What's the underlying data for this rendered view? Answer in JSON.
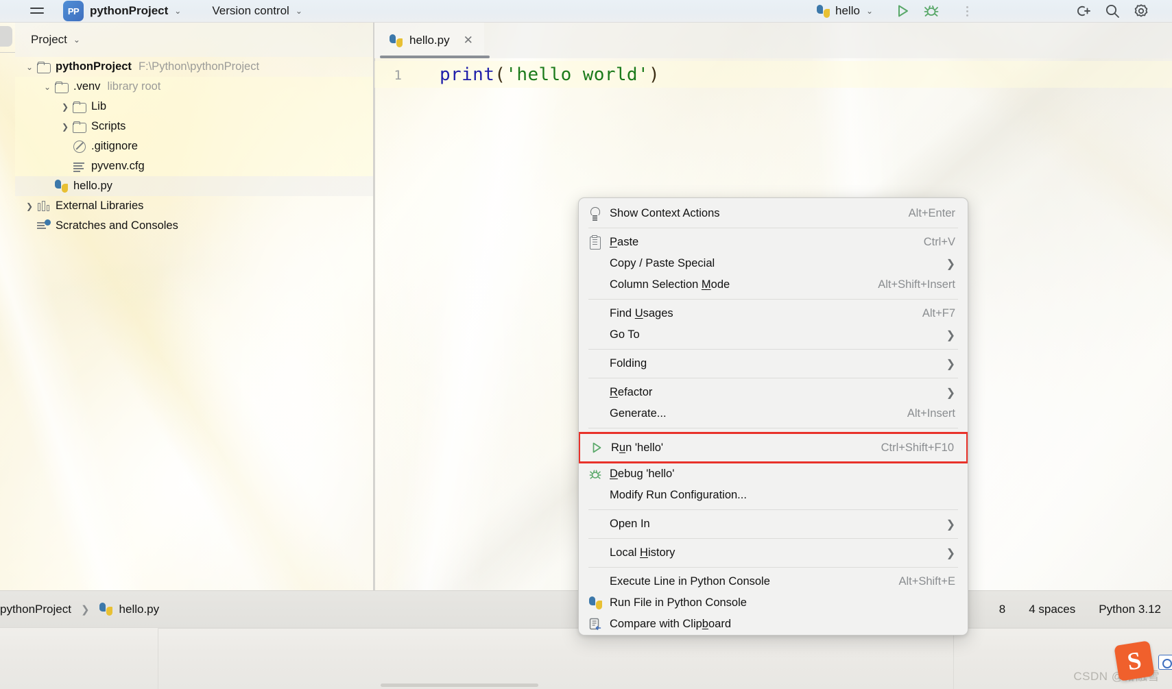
{
  "toolbar": {
    "burger_icon": "hamburger-menu-icon",
    "project_badge": "PP",
    "project_name": "pythonProject",
    "version_control": "Version control",
    "run_config_name": "hello",
    "chevron_icon": "chevron-down-icon",
    "run_icon": "run-triangle-icon",
    "debug_icon": "debug-bug-icon",
    "more_icon": "more-vertical-dots-icon",
    "ai_icon": "code-with-me-icon",
    "search_icon": "search-icon",
    "settings_icon": "gear-icon"
  },
  "left_stripe": {
    "items": [
      "project-tool-window-icon",
      "commit-icon",
      "bookmarks-icon",
      "structure-icon",
      "notifications-icon",
      "terminal-icon",
      "python-packages-icon",
      "problems-icon",
      "services-icon"
    ]
  },
  "project_panel": {
    "title": "Project",
    "title_chevron": "chevron-down-icon",
    "tree": [
      {
        "label": "pythonProject",
        "sub": "F:\\Python\\pythonProject",
        "indent": 0,
        "arrow": "chevron-down-icon",
        "icon": "folder-icon",
        "bold": true,
        "highlight": "none"
      },
      {
        "label": ".venv",
        "sub": "library root",
        "indent": 1,
        "arrow": "chevron-down-icon",
        "icon": "folder-icon",
        "bold": false,
        "highlight": "yellow"
      },
      {
        "label": "Lib",
        "sub": "",
        "indent": 2,
        "arrow": "chevron-right-icon",
        "icon": "folder-icon",
        "bold": false,
        "highlight": "yellow"
      },
      {
        "label": "Scripts",
        "sub": "",
        "indent": 2,
        "arrow": "chevron-right-icon",
        "icon": "folder-icon",
        "bold": false,
        "highlight": "yellow"
      },
      {
        "label": ".gitignore",
        "sub": "",
        "indent": 2,
        "arrow": "none",
        "icon": "gitignore-file-icon",
        "bold": false,
        "highlight": "yellow"
      },
      {
        "label": "pyvenv.cfg",
        "sub": "",
        "indent": 2,
        "arrow": "none",
        "icon": "config-file-icon",
        "bold": false,
        "highlight": "yellow"
      },
      {
        "label": "hello.py",
        "sub": "",
        "indent": 1,
        "arrow": "none",
        "icon": "python-file-icon",
        "bold": false,
        "highlight": "grey"
      },
      {
        "label": "External Libraries",
        "sub": "",
        "indent": 0,
        "arrow": "chevron-right-icon",
        "icon": "library-icon",
        "bold": false,
        "highlight": "none"
      },
      {
        "label": "Scratches and Consoles",
        "sub": "",
        "indent": 0,
        "arrow": "none",
        "icon": "scratches-icon",
        "bold": false,
        "highlight": "none"
      }
    ]
  },
  "editor": {
    "tab": {
      "name": "hello.py",
      "icon": "python-file-icon",
      "close_icon": "close-icon"
    },
    "line_numbers": [
      "1"
    ],
    "code": {
      "func": "print",
      "open_paren": "(",
      "string": "'hello world'",
      "close_paren": ")"
    }
  },
  "context_menu": {
    "groups": [
      {
        "items": [
          {
            "icon": "lightbulb-icon",
            "label": "Show Context Actions",
            "mnemonic": "",
            "accel": "Alt+Enter",
            "submenu": false
          }
        ]
      },
      {
        "items": [
          {
            "icon": "clipboard-icon",
            "label": "Paste",
            "mnemonic": "P",
            "accel": "Ctrl+V",
            "submenu": false
          },
          {
            "icon": "",
            "label": "Copy / Paste Special",
            "mnemonic": "",
            "accel": "",
            "submenu": true
          },
          {
            "icon": "",
            "label": "Column Selection Mode",
            "mnemonic": "M",
            "accel": "Alt+Shift+Insert",
            "submenu": false
          }
        ]
      },
      {
        "items": [
          {
            "icon": "",
            "label": "Find Usages",
            "mnemonic": "U",
            "accel": "Alt+F7",
            "submenu": false
          },
          {
            "icon": "",
            "label": "Go To",
            "mnemonic": "",
            "accel": "",
            "submenu": true
          }
        ]
      },
      {
        "items": [
          {
            "icon": "",
            "label": "Folding",
            "mnemonic": "",
            "accel": "",
            "submenu": true
          }
        ]
      },
      {
        "items": [
          {
            "icon": "",
            "label": "Refactor",
            "mnemonic": "R",
            "accel": "",
            "submenu": true
          },
          {
            "icon": "",
            "label": "Generate...",
            "mnemonic": "",
            "accel": "Alt+Insert",
            "submenu": false
          }
        ]
      },
      {
        "items": [
          {
            "icon": "run-triangle-icon",
            "label": "Run 'hello'",
            "mnemonic": "u",
            "accel": "Ctrl+Shift+F10",
            "submenu": false,
            "selected": true
          },
          {
            "icon": "debug-bug-icon",
            "label": "Debug 'hello'",
            "mnemonic": "D",
            "accel": "",
            "submenu": false
          },
          {
            "icon": "",
            "label": "Modify Run Configuration...",
            "mnemonic": "",
            "accel": "",
            "submenu": false
          }
        ]
      },
      {
        "items": [
          {
            "icon": "",
            "label": "Open In",
            "mnemonic": "",
            "accel": "",
            "submenu": true
          }
        ]
      },
      {
        "items": [
          {
            "icon": "",
            "label": "Local History",
            "mnemonic": "H",
            "accel": "",
            "submenu": true
          }
        ]
      },
      {
        "items": [
          {
            "icon": "",
            "label": "Execute Line in Python Console",
            "mnemonic": "",
            "accel": "Alt+Shift+E",
            "submenu": false
          },
          {
            "icon": "python-file-icon",
            "label": "Run File in Python Console",
            "mnemonic": "",
            "accel": "",
            "submenu": false
          },
          {
            "icon": "compare-clipboard-icon",
            "label": "Compare with Clipboard",
            "mnemonic": "b",
            "accel": "",
            "submenu": false
          }
        ]
      }
    ],
    "highlight_color": "#e8322a"
  },
  "breadcrumbs": {
    "items": [
      {
        "label": "pythonProject",
        "icon": ""
      },
      {
        "label": "hello.py",
        "icon": "python-file-icon"
      }
    ],
    "separator": "chevron-right-icon"
  },
  "status_bar": {
    "caret_position": "8",
    "indent": "4 spaces",
    "interpreter": "Python 3.12"
  },
  "watermark": {
    "text": "CSDN @椿融雪",
    "ime_logo": "S"
  }
}
